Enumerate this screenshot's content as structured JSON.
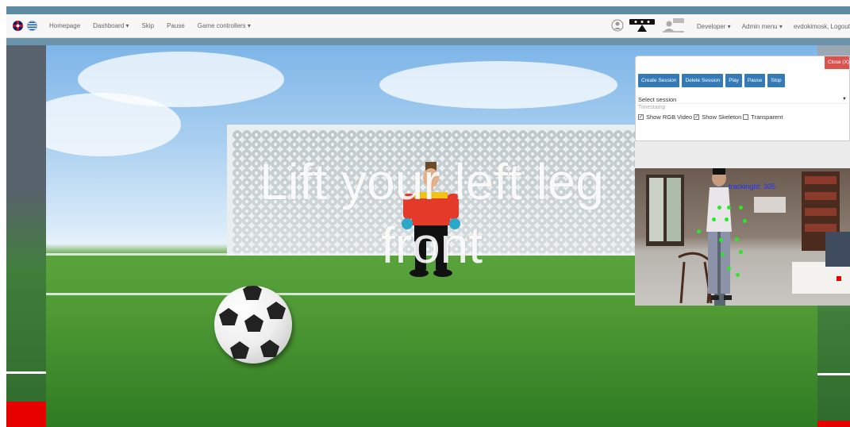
{
  "navbar": {
    "flags": [
      "uk-flag-icon",
      "greece-flag-icon"
    ],
    "items": [
      {
        "label": "Homepage"
      },
      {
        "label": "Dashboard ▾"
      },
      {
        "label": "Skip"
      },
      {
        "label": "Pause"
      },
      {
        "label": "Game controllers ▾"
      }
    ],
    "right_icons": [
      "user-circle-icon",
      "kinect-sensor-icon",
      "person-desk-icon"
    ],
    "right_items": [
      {
        "label": "Developer ▾"
      },
      {
        "label": "Admin menu ▾"
      },
      {
        "label": "evdokimosk, Logout"
      }
    ]
  },
  "game": {
    "instruction_line1": "Lift your left leg",
    "instruction_line2": "front"
  },
  "session_panel": {
    "close_label": "Close (X)",
    "buttons": [
      "Create Session",
      "Delete Session",
      "Play",
      "Pause",
      "Stop"
    ],
    "select_value": "Select session",
    "timestamp_label": "Timestamp",
    "checkboxes": [
      {
        "label": "Show RGB Video",
        "checked": true
      },
      {
        "label": "Show Skeleton",
        "checked": true
      },
      {
        "label": "Transparent",
        "checked": false
      }
    ],
    "tracking_text": "trackingId: 305"
  },
  "colors": {
    "navbar_stripe": "#5e8aa3",
    "button_blue": "#337ab7",
    "close_red": "#d9534f",
    "joint_green": "#29e829",
    "tracking_blue": "#1a35ff",
    "side_red": "#e60000"
  }
}
